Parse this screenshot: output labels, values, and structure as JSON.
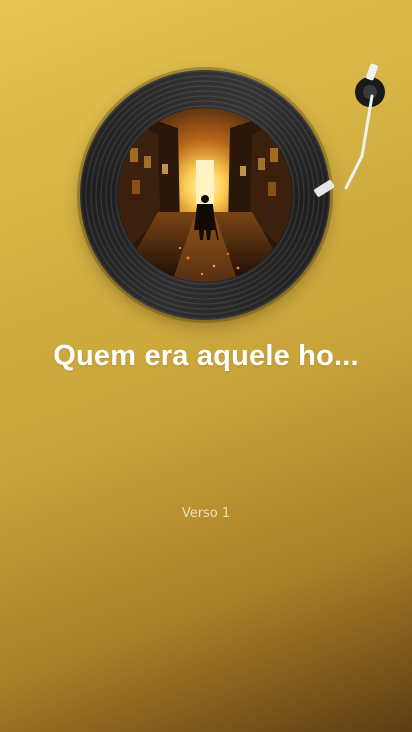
{
  "player": {
    "song_title": "Quem era aquele ho...",
    "verse_label": "Verso 1",
    "cover_art": "silhouette-in-lit-alley",
    "colors": {
      "background_top": "#e6c553",
      "background_bottom": "#5c3d12",
      "record": "#1e1e1f",
      "title_text": "#ffffff",
      "verse_text": "#ece0b6"
    },
    "icons": [
      "vinyl-record-icon",
      "tonearm-icon"
    ]
  }
}
